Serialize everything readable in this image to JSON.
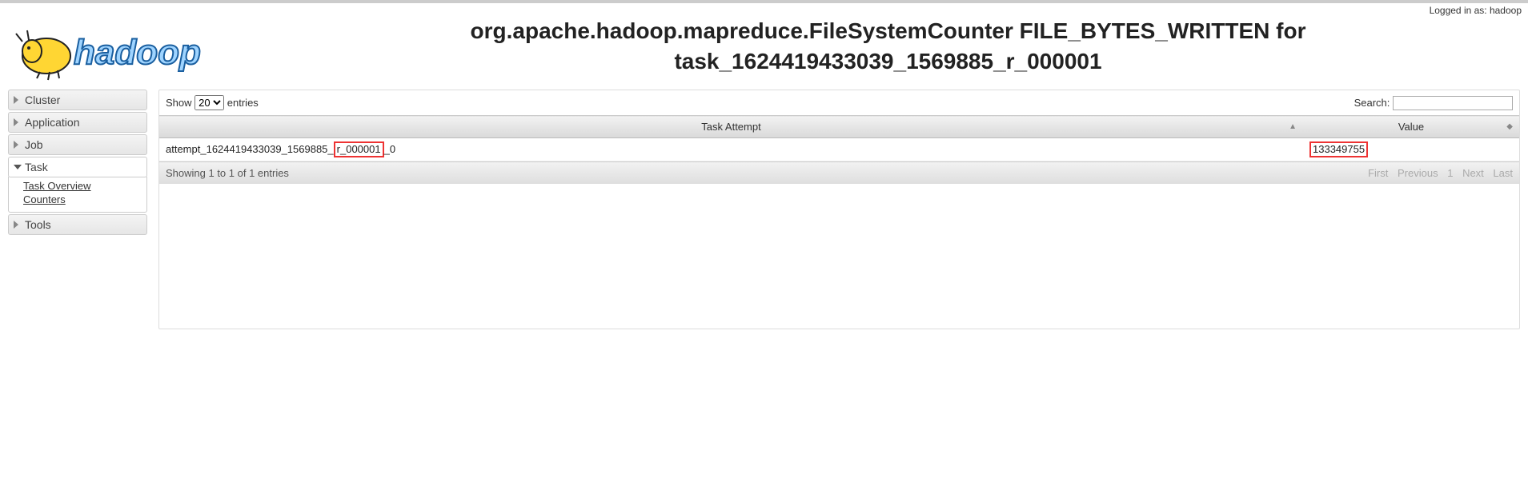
{
  "login_text": "Logged in as: hadoop",
  "title": "org.apache.hadoop.mapreduce.FileSystemCounter FILE_BYTES_WRITTEN for task_1624419433039_1569885_r_000001",
  "sidebar": {
    "items": [
      {
        "label": "Cluster",
        "active": false
      },
      {
        "label": "Application",
        "active": false
      },
      {
        "label": "Job",
        "active": false
      },
      {
        "label": "Task",
        "active": true,
        "links": [
          "Task Overview",
          "Counters"
        ]
      },
      {
        "label": "Tools",
        "active": false
      }
    ]
  },
  "table_controls": {
    "show_label_pre": "Show",
    "show_label_post": "entries",
    "page_size": "20",
    "search_label": "Search:"
  },
  "columns": [
    "Task Attempt",
    "Value"
  ],
  "rows": [
    {
      "attempt_pre": "attempt_1624419433039_1569885_",
      "attempt_hl": "r_000001",
      "attempt_post": "_0",
      "value": "133349755"
    }
  ],
  "footer": {
    "info": "Showing 1 to 1 of 1 entries",
    "pager": [
      "First",
      "Previous",
      "1",
      "Next",
      "Last"
    ]
  }
}
